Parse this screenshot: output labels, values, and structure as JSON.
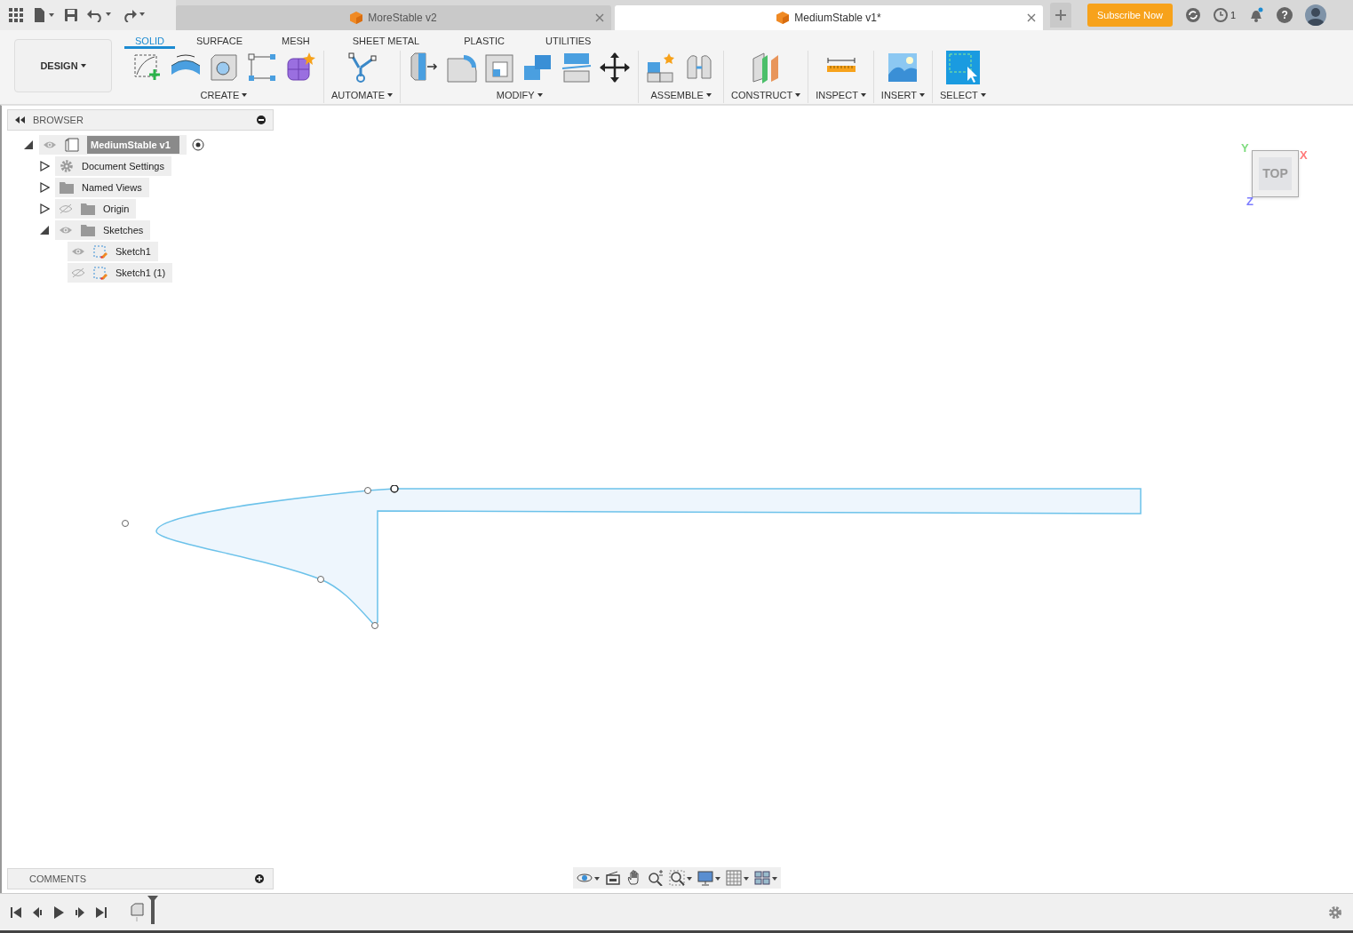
{
  "title_bar": {
    "document_tabs": [
      {
        "label": "MoreStable v2",
        "selected": false
      },
      {
        "label": "MediumStable v1*",
        "selected": true
      }
    ],
    "subscribe_button": "Subscribe Now",
    "job_count": "1",
    "help_glyph": "?"
  },
  "workspace_button": "DESIGN",
  "toolbar_tabs": [
    {
      "label": "SOLID",
      "selected": true
    },
    {
      "label": "SURFACE",
      "selected": false
    },
    {
      "label": "MESH",
      "selected": false
    },
    {
      "label": "SHEET METAL",
      "selected": false
    },
    {
      "label": "PLASTIC",
      "selected": false
    },
    {
      "label": "UTILITIES",
      "selected": false
    }
  ],
  "tool_groups": [
    {
      "label": "CREATE",
      "kind": "create"
    },
    {
      "label": "AUTOMATE",
      "kind": "automate"
    },
    {
      "label": "MODIFY",
      "kind": "modify"
    },
    {
      "label": "ASSEMBLE",
      "kind": "assemble"
    },
    {
      "label": "CONSTRUCT",
      "kind": "construct"
    },
    {
      "label": "INSPECT",
      "kind": "inspect"
    },
    {
      "label": "INSERT",
      "kind": "insert"
    },
    {
      "label": "SELECT",
      "kind": "select"
    }
  ],
  "browser": {
    "title": "BROWSER",
    "tree": [
      {
        "label": "MediumStable v1",
        "kind": "component",
        "expanded": true,
        "visible": true,
        "selected": true,
        "active": true,
        "children": [
          {
            "label": "Document Settings",
            "kind": "settings",
            "expanded": false,
            "selected": false
          },
          {
            "label": "Named Views",
            "kind": "folder",
            "expanded": false,
            "selected": false
          },
          {
            "label": "Origin",
            "kind": "folder",
            "expanded": false,
            "visible": false,
            "selected": false
          },
          {
            "label": "Sketches",
            "kind": "folder",
            "expanded": true,
            "visible": true,
            "selected": false,
            "children": [
              {
                "label": "Sketch1",
                "kind": "sketch",
                "visible": true,
                "selected": false
              },
              {
                "label": "Sketch1 (1)",
                "kind": "sketch",
                "visible": false,
                "selected": false
              }
            ]
          }
        ]
      }
    ]
  },
  "view_cube": {
    "face": "TOP",
    "axes": [
      {
        "label": "Y",
        "color": "#7fdc7f"
      },
      {
        "label": "X",
        "color": "#ff7a7a"
      },
      {
        "label": "Z",
        "color": "#7c7cff"
      }
    ]
  },
  "comments": {
    "title": "COMMENTS"
  }
}
